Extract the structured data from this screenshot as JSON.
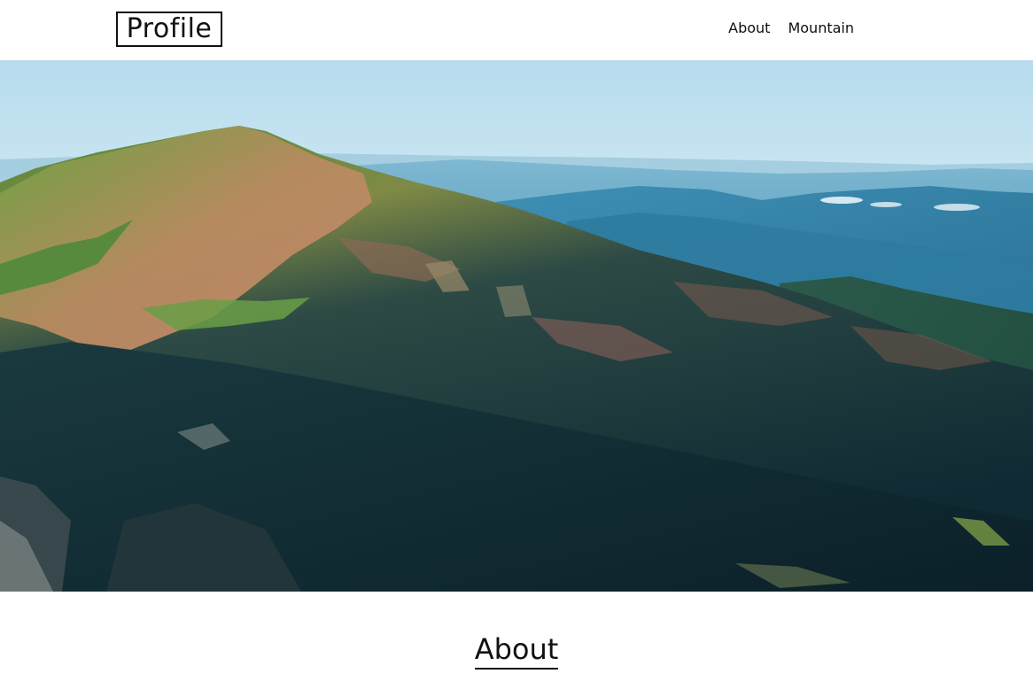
{
  "header": {
    "logo": "Profile",
    "nav": [
      {
        "label": "About"
      },
      {
        "label": "Mountain"
      }
    ]
  },
  "hero": {
    "image": "mountain-ridge-landscape"
  },
  "about": {
    "title": "About"
  }
}
